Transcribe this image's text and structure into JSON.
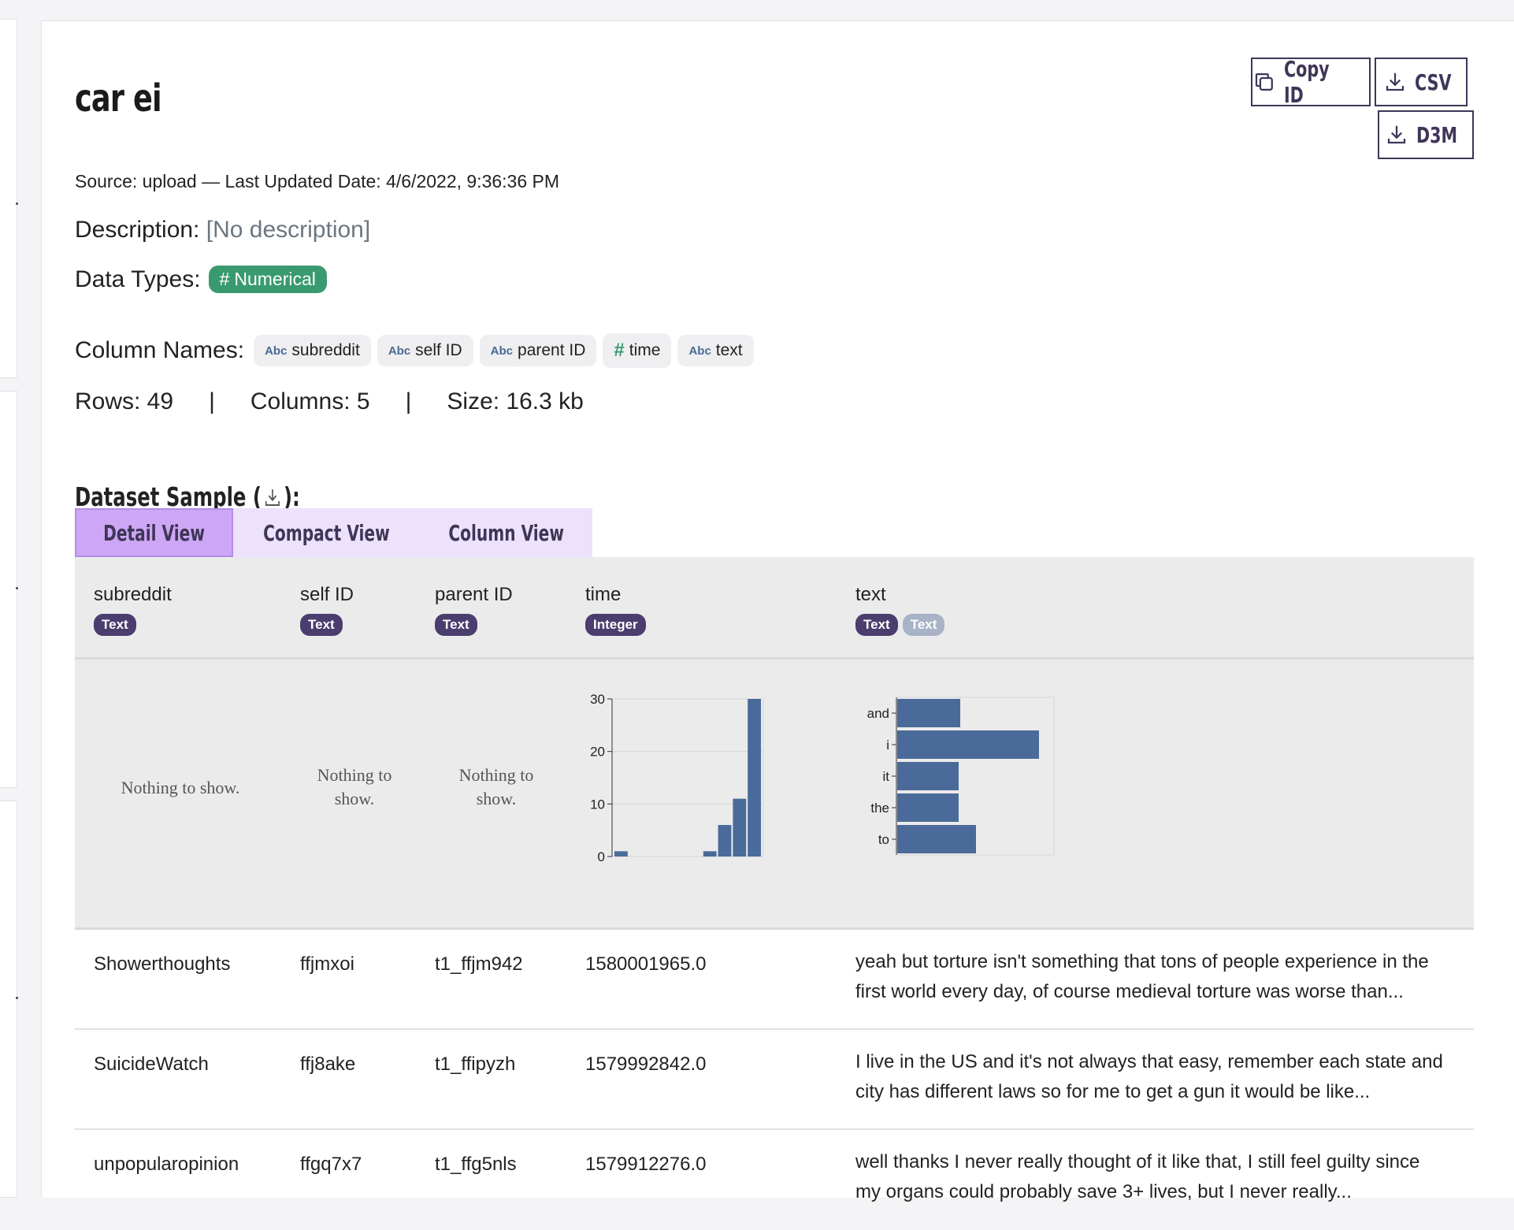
{
  "dataset": {
    "title": "car ei",
    "source_line": "Source: upload — Last Updated Date: 4/6/2022, 9:36:36 PM",
    "description_label": "Description:",
    "description_value": "[No description]",
    "data_types_label": "Data Types:",
    "data_types": [
      "Numerical"
    ],
    "column_names_label": "Column Names:",
    "column_names": [
      {
        "icon": "Abc",
        "name": "subreddit"
      },
      {
        "icon": "Abc",
        "name": "self ID"
      },
      {
        "icon": "Abc",
        "name": "parent ID"
      },
      {
        "icon": "#",
        "name": "time"
      },
      {
        "icon": "Abc",
        "name": "text"
      }
    ],
    "rows": "Rows: 49",
    "columns": "Columns: 5",
    "size": "Size: 16.3 kb",
    "separator": "|"
  },
  "buttons": {
    "copy_id": "Copy ID",
    "csv": "CSV",
    "d3m": "D3M"
  },
  "sample": {
    "heading_before": "Dataset Sample (",
    "heading_after": "):",
    "tabs": [
      "Detail View",
      "Compact View",
      "Column View"
    ],
    "active_tab": "Detail View"
  },
  "table": {
    "columns": [
      {
        "name": "subreddit",
        "types": [
          "Text"
        ]
      },
      {
        "name": "self ID",
        "types": [
          "Text"
        ]
      },
      {
        "name": "parent ID",
        "types": [
          "Text"
        ]
      },
      {
        "name": "time",
        "types": [
          "Integer"
        ]
      },
      {
        "name": "text",
        "types": [
          "Text",
          "Text"
        ]
      }
    ],
    "nothing_subreddit": "Nothing to show.",
    "nothing_self_l1": "Nothing to",
    "nothing_self_l2": "show.",
    "nothing_parent_l1": "Nothing to",
    "nothing_parent_l2": "show.",
    "rows": [
      {
        "subreddit": "Showerthoughts",
        "self_id": "ffjmxoi",
        "parent_id": "t1_ffjm942",
        "time": "1580001965.0",
        "text_l1": "yeah but torture isn't something that tons of people experience in the",
        "text_l2": "first world every day, of course medieval torture was worse than..."
      },
      {
        "subreddit": "SuicideWatch",
        "self_id": "ffj8ake",
        "parent_id": "t1_ffipyzh",
        "time": "1579992842.0",
        "text_l1": "I live in the US and it's not always that easy, remember each state and",
        "text_l2": "city has different laws so for me to get a gun it would be like..."
      },
      {
        "subreddit": "unpopularopinion",
        "self_id": "ffgq7x7",
        "parent_id": "t1_ffg5nls",
        "time": "1579912276.0",
        "text_l1": "well thanks I never really thought of it like that, I still feel guilty since",
        "text_l2": "my organs could probably save 3+ lives, but I never really..."
      }
    ]
  },
  "colors": {
    "accent": "#3f3558",
    "numerical_tag": "#3a9a6f",
    "bar": "#4a6b99",
    "tab_active": "#cda7f5",
    "tab_bg": "#ece2fb"
  },
  "chart_data": [
    {
      "type": "bar",
      "subtype": "histogram",
      "x": [
        1,
        2,
        3,
        4,
        5,
        6,
        7,
        8,
        9,
        10
      ],
      "values": [
        1,
        0,
        0,
        0,
        0,
        0,
        1,
        6,
        11,
        30
      ],
      "yticks": [
        "0",
        "10",
        "20",
        "30"
      ],
      "ylim": [
        0,
        30
      ],
      "grid": true
    },
    {
      "type": "bar",
      "orientation": "horizontal",
      "categories": [
        "and",
        "i",
        "it",
        "the",
        "to"
      ],
      "values": [
        4,
        9,
        3.9,
        3.9,
        5
      ],
      "grid": true
    }
  ]
}
